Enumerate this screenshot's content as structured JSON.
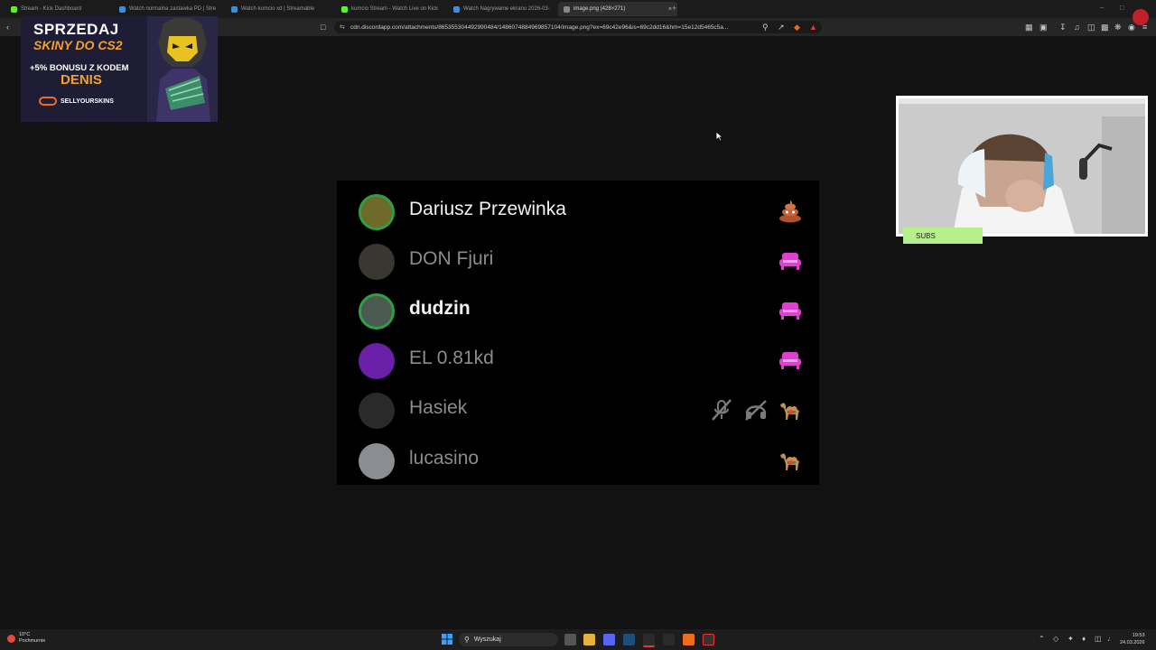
{
  "browser": {
    "tabs": [
      {
        "title": "Stream - Kick Dashboard",
        "favicon_color": "#53fc18"
      },
      {
        "title": "Watch normalna zastawka PD | Stre",
        "favicon_color": "#3b8fd6"
      },
      {
        "title": "Watch kumcio xd | Streamable",
        "favicon_color": "#3b8fd6"
      },
      {
        "title": "kumcio Stream - Watch Live on Kick",
        "favicon_color": "#53fc18"
      },
      {
        "title": "Watch Nagrywanie ekranu 2026-03-",
        "favicon_color": "#3b8fd6"
      },
      {
        "title": "image.png (428×271)",
        "favicon_color": "#888888",
        "active": true
      }
    ],
    "address": "cdn.discordapp.com/attachments/865355304492990484/1486074884969857104/image.png?ex=69c42e96&is=69c2dd16&hm=15e12d5465c5a..."
  },
  "ad": {
    "line1": "SPRZEDAJ",
    "line2": "SKINY DO CS2",
    "bonus": "+5% BONUSU Z KODEM",
    "code": "DENIS",
    "brand": "SELLYOURSKINS",
    "accent": "#f2a128"
  },
  "voice_list": {
    "users": [
      {
        "name": "Dariusz Przewinka",
        "speaking": true,
        "bright": true,
        "bold": false,
        "avatar_color": "#6d6a2a",
        "icons": [
          "poop-icon"
        ]
      },
      {
        "name": "DON Fjuri",
        "speaking": false,
        "bright": false,
        "bold": false,
        "avatar_color": "#3a3630",
        "icons": [
          "couch-icon"
        ]
      },
      {
        "name": "dudzin",
        "speaking": true,
        "bright": true,
        "bold": true,
        "avatar_color": "#4a5a50",
        "icons": [
          "couch-icon"
        ]
      },
      {
        "name": "EL 0.81kd",
        "speaking": false,
        "bright": false,
        "bold": false,
        "avatar_color": "#6a1fa8",
        "icons": [
          "couch-icon"
        ]
      },
      {
        "name": "Hasiek",
        "speaking": false,
        "bright": false,
        "bold": false,
        "avatar_color": "#2a2a2a",
        "icons": [
          "mic-muted-icon",
          "headphones-deafened-icon",
          "camel-icon"
        ]
      },
      {
        "name": "lucasino",
        "speaking": false,
        "bright": false,
        "bold": false,
        "avatar_color": "#8a8e92",
        "icons": [
          "camel-icon"
        ]
      }
    ],
    "speaking_color": "#2ea043",
    "couch_color": "#e040d0"
  },
  "webcam": {
    "subs_label": "SUBS"
  },
  "taskbar": {
    "weather_temp": "10°C",
    "weather_desc": "Pochmurnie",
    "search_placeholder": "Wyszukaj",
    "time": "19:53",
    "date": "24.03.2026"
  }
}
